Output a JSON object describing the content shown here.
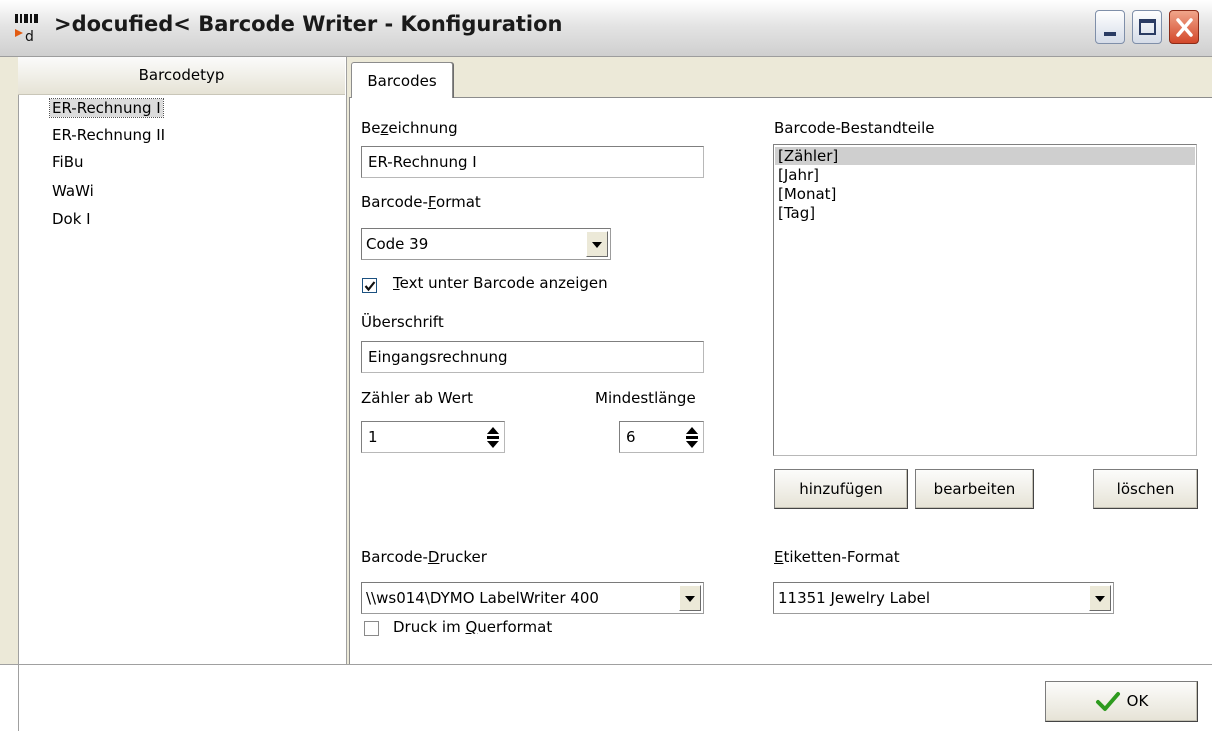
{
  "window": {
    "title": ">docufied< Barcode Writer - Konfiguration"
  },
  "icons": [
    "app-icon",
    "minimize-icon",
    "maximize-icon",
    "close-icon",
    "checkmark-icon",
    "dropdown-arrow-icon",
    "spin-arrow-icon"
  ],
  "colors": {
    "ok_check": "#2e9b1f",
    "close_button": "#d3482a",
    "selection": "#cfcfcf"
  },
  "sidebar": {
    "header": "Barcodetyp",
    "items": [
      {
        "label": "ER-Rechnung I",
        "selected": true
      },
      {
        "label": "ER-Rechnung II"
      },
      {
        "label": "FiBu"
      },
      {
        "label": "WaWi"
      },
      {
        "label": "Dok I"
      }
    ]
  },
  "tabs": [
    {
      "label": "Barcodes",
      "active": true
    }
  ],
  "form": {
    "bezeichnung_label_pre": "Be",
    "bezeichnung_label_u": "z",
    "bezeichnung_label_post": "eichnung",
    "bezeichnung_value": "ER-Rechnung I",
    "format_label_pre": "Barcode-",
    "format_label_u": "F",
    "format_label_post": "ormat",
    "format_value": "Code 39",
    "text_checkbox_u": "T",
    "text_checkbox_rest": "ext unter Barcode anzeigen",
    "text_checkbox_checked": true,
    "ueberschrift_label": "Überschrift",
    "ueberschrift_value": "Eingangsrechnung",
    "zaehler_label": "Zähler ab Wert",
    "zaehler_value": "1",
    "mindestlaenge_label": "Mindestlänge",
    "mindestlaenge_value": "6",
    "drucker_label_pre": "Barcode-",
    "drucker_label_u": "D",
    "drucker_label_post": "rucker",
    "drucker_value": "\\\\ws014\\DYMO LabelWriter 400",
    "querformat_pre": "Druck im ",
    "querformat_u": "Q",
    "querformat_post": "uerformat",
    "querformat_checked": false,
    "bestandteile_label": "Barcode-Bestandteile",
    "bestandteile_items": [
      "[Zähler]",
      "[Jahr]",
      "[Monat]",
      "[Tag]"
    ],
    "add_button": "hinzufügen",
    "edit_button": "bearbeiten",
    "delete_button": "löschen",
    "etiketten_label_u": "E",
    "etiketten_label_rest": "tiketten-Format",
    "etiketten_value": "11351 Jewelry Label"
  },
  "footer": {
    "ok_button": "OK"
  }
}
